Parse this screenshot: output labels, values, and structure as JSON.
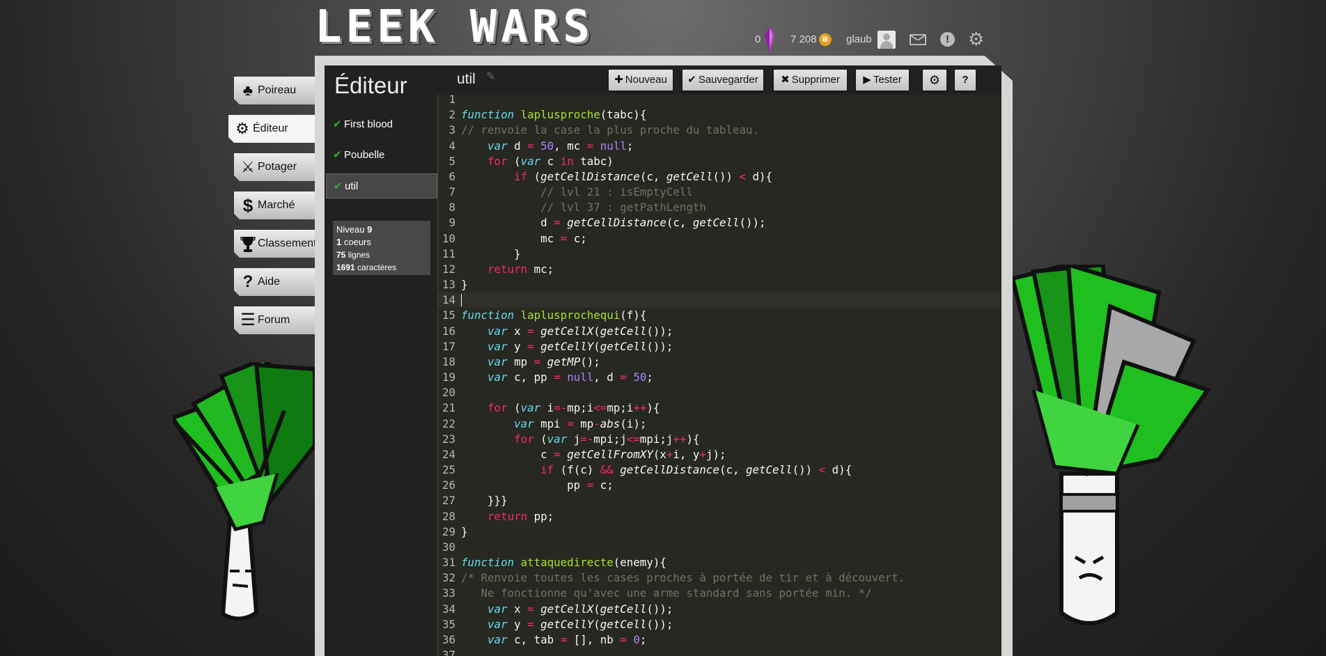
{
  "header": {
    "logo": "LEEK WARS",
    "crystals": "0",
    "habs": "7 208",
    "coin_symbol": "Ƀ",
    "username": "glaub"
  },
  "menu": [
    {
      "label": "Poireau",
      "icon": "leek-icon"
    },
    {
      "label": "Éditeur",
      "icon": "gear-icon"
    },
    {
      "label": "Potager",
      "icon": "swords-icon"
    },
    {
      "label": "Marché",
      "icon": "dollar-icon"
    },
    {
      "label": "Classement",
      "icon": "trophy-icon"
    },
    {
      "label": "Aide",
      "icon": "question-icon"
    },
    {
      "label": "Forum",
      "icon": "list-icon"
    }
  ],
  "editor": {
    "title": "Éditeur",
    "files": [
      "First blood",
      "Poubelle",
      "util"
    ],
    "current_file": "util",
    "stats": {
      "level_label": "Niveau",
      "level": "9",
      "cores": "1",
      "cores_label": "coeurs",
      "lines": "75",
      "lines_label": "lignes",
      "chars": "1691",
      "chars_label": "caractères"
    }
  },
  "toolbar": {
    "new_icon": "✚",
    "new_label": "Nouveau",
    "save_icon": "✔",
    "save_label": "Sauvegarder",
    "delete_icon": "✖",
    "delete_label": "Supprimer",
    "test_icon": "▶",
    "test_label": "Tester",
    "help_label": "?"
  },
  "code": {
    "active_line": 14,
    "lines": [
      "",
      "function laplusproche(tabc){",
      "// renvoie la case la plus proche du tableau.",
      "    var d = 50, mc = null;",
      "    for (var c in tabc)",
      "        if (getCellDistance(c, getCell()) < d){",
      "            // lvl 21 : isEmptyCell",
      "            // lvl 37 : getPathLength",
      "            d = getCellDistance(c, getCell());",
      "            mc = c;",
      "        }",
      "    return mc;",
      "}",
      "",
      "function laplusprochequi(f){",
      "    var x = getCellX(getCell());",
      "    var y = getCellY(getCell());",
      "    var mp = getMP();",
      "    var c, pp = null, d = 50;",
      "",
      "    for (var i=-mp;i<=mp;i++){",
      "        var mpi = mp-abs(i);",
      "        for (var j=-mpi;j<=mpi;j++){",
      "            c = getCellFromXY(x+i, y+j);",
      "            if (f(c) && getCellDistance(c, getCell()) < d){",
      "                pp = c;",
      "    }}}",
      "    return pp;",
      "}",
      "",
      "function attaquedirecte(enemy){",
      "/* Renvoie toutes les cases proches à portée de tir et à découvert.",
      "   Ne fonctionne qu'avec une arme standard sans portée min. */",
      "    var x = getCellX(getCell());",
      "    var y = getCellY(getCell());",
      "    var c, tab = [], nb = 0;",
      ""
    ]
  }
}
